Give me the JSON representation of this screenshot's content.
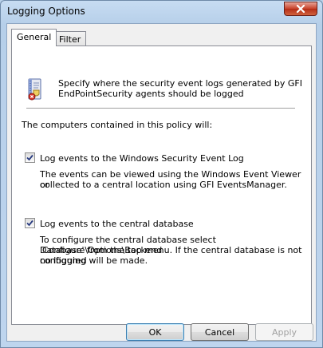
{
  "window": {
    "title": "Logging Options"
  },
  "tabs": [
    {
      "label": "General",
      "active": true
    },
    {
      "label": "Filter",
      "active": false
    }
  ],
  "general": {
    "description_line1": "Specify where the security event logs generated by GFI",
    "description_line2": "EndPointSecurity agents should be logged",
    "intro": "The computers contained in this policy will:",
    "options": [
      {
        "label": "Log events to the Windows Security Event Log",
        "checked": true,
        "help_lines": [
          "The events can be viewed using the Windows Event Viewer or",
          "collected to a central location using GFI EventsManager."
        ]
      },
      {
        "label": "Log events to the central database",
        "checked": true,
        "help_lines": [
          "To configure the central database select 'Configure\\Options\\Backend",
          "Database' from the top menu. If the central database is not configured",
          "no logging will be made."
        ]
      }
    ]
  },
  "buttons": {
    "ok": "OK",
    "cancel": "Cancel",
    "apply": "Apply"
  },
  "icons": {
    "close": "close-icon",
    "policy": "policy-log-icon",
    "check": "checkmark-icon"
  },
  "colors": {
    "titlebar": "#c7dcf2",
    "close_button": "#c8422a",
    "panel": "#ffffff",
    "dialog_face": "#f0f0f0"
  }
}
